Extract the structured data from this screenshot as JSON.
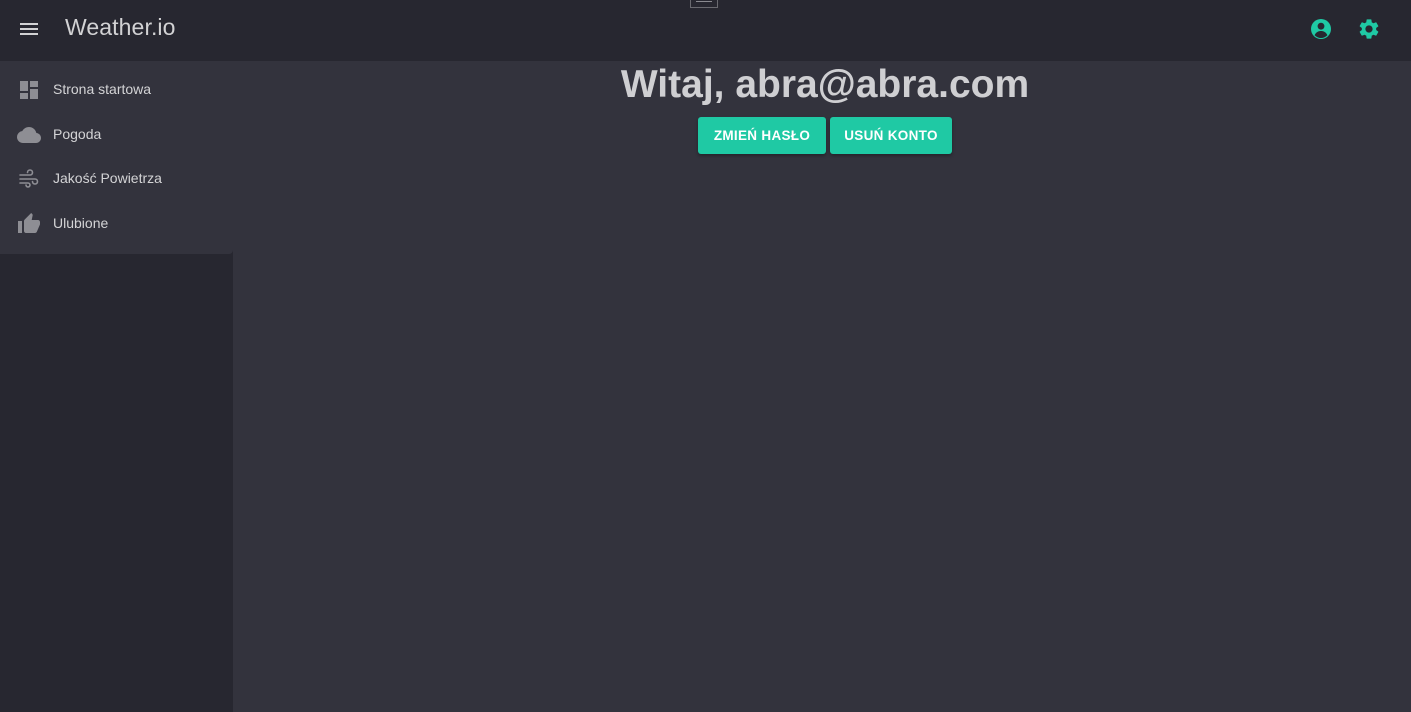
{
  "header": {
    "title": "Weather.io",
    "menu_icon": "hamburger-menu-icon",
    "account_icon": "account-circle-icon",
    "settings_icon": "gear-icon"
  },
  "sidebar": {
    "items": [
      {
        "label": "Strona startowa",
        "icon": "dashboard-icon"
      },
      {
        "label": "Pogoda",
        "icon": "cloud-icon"
      },
      {
        "label": "Jakość Powietrza",
        "icon": "wind-icon"
      },
      {
        "label": "Ulubione",
        "icon": "thumb-up-icon"
      }
    ]
  },
  "main": {
    "greeting": "Witaj, abra@abra.com",
    "change_password_label": "ZMIEŃ HASŁO",
    "delete_account_label": "USUŃ KONTO"
  },
  "colors": {
    "accent": "#1fc9a4",
    "topbar_bg": "#272730",
    "content_bg": "#33333d",
    "icon_gray": "#8e8e94",
    "text": "#d2d2d4"
  }
}
